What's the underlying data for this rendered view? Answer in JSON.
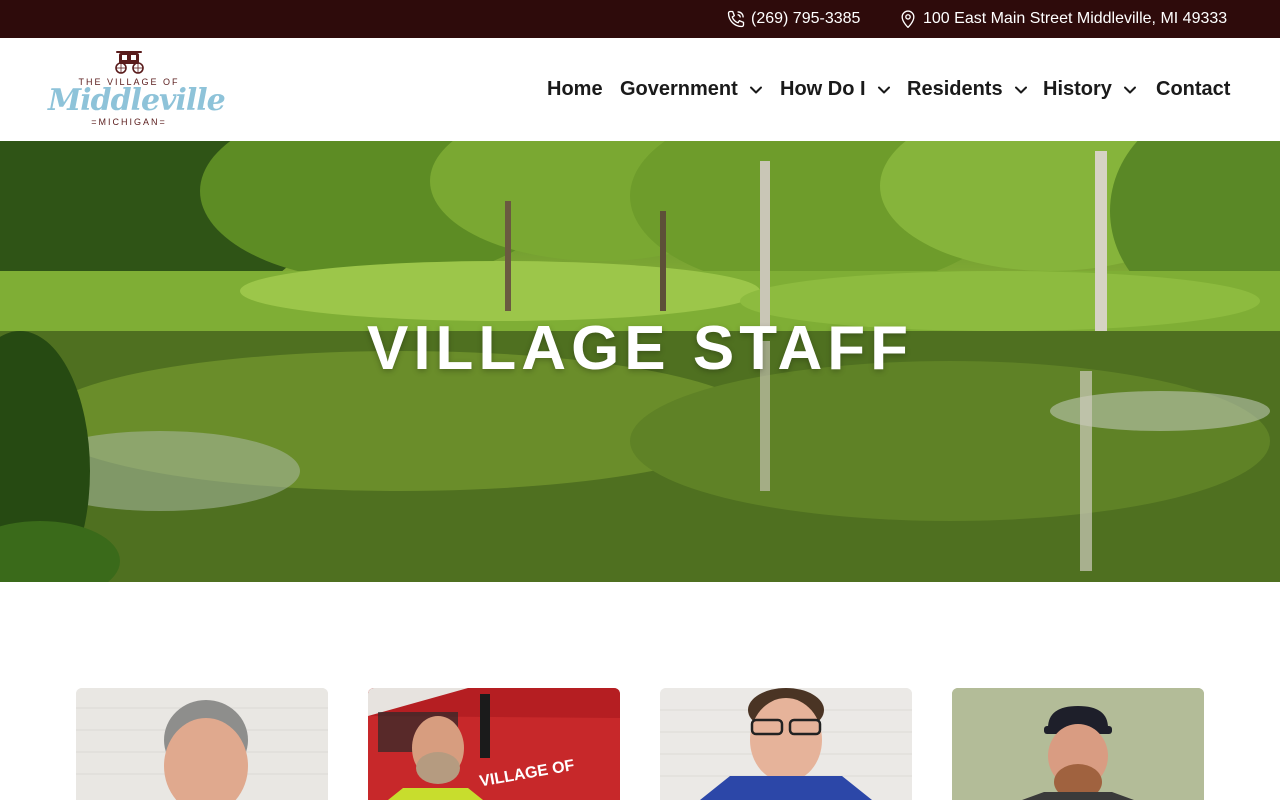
{
  "topbar": {
    "phone": "(269) 795-3385",
    "phone_icon": "phone-icon",
    "address": "100 East Main Street Middleville, MI 49333",
    "address_icon": "map-pin-icon",
    "background": "#2e0b0b"
  },
  "logo": {
    "top_text": "THE VILLAGE OF",
    "script_text": "Middleville",
    "bottom_text": "=MICHIGAN=",
    "icon": "stagecoach-icon"
  },
  "nav": {
    "items": [
      {
        "label": "Home",
        "has_dropdown": false
      },
      {
        "label": "Government",
        "has_dropdown": true
      },
      {
        "label": "How Do I",
        "has_dropdown": true
      },
      {
        "label": "Residents",
        "has_dropdown": true
      },
      {
        "label": "History",
        "has_dropdown": true
      },
      {
        "label": "Contact",
        "has_dropdown": false
      }
    ],
    "dropdown_icon": "chevron-down-icon"
  },
  "hero": {
    "title": "VILLAGE STAFF"
  },
  "staff_cards": [
    {
      "image": "staff-photo"
    },
    {
      "image": "staff-photo"
    },
    {
      "image": "staff-photo"
    },
    {
      "image": "staff-photo"
    }
  ]
}
